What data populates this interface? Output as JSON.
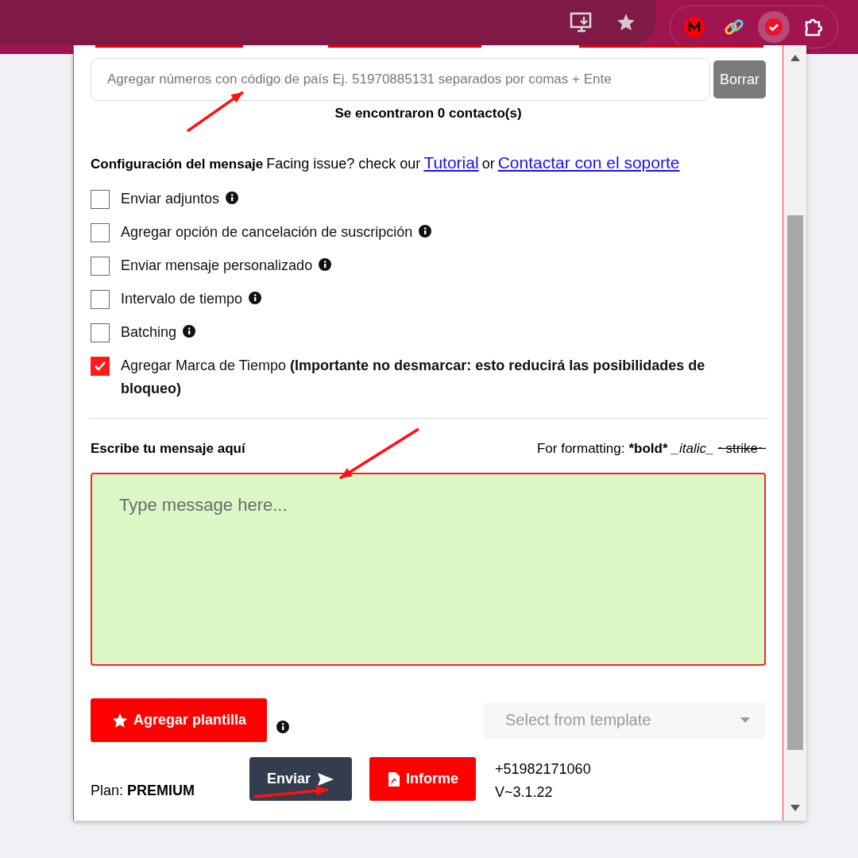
{
  "numbers": {
    "placeholder": "Agregar números con código de país Ej. 51970885131 separados por comas + Ente",
    "clear_button": "Borrar",
    "found": "Se encontraron 0 contacto(s)"
  },
  "settings": {
    "title": "Configuración del mensaje",
    "help_prefix": "Facing issue? check our",
    "help_link": "Tutorial",
    "help_joiner": "or",
    "support_link": "Contactar con el soporte"
  },
  "options": [
    {
      "label": "Enviar adjuntos ",
      "checked": false,
      "info": true
    },
    {
      "label": "Agregar opción de cancelación de suscripción",
      "checked": false,
      "info": true
    },
    {
      "label": "Enviar mensaje personalizado",
      "checked": false,
      "info": true
    },
    {
      "label": "Intervalo de tiempo",
      "checked": false,
      "info": true
    },
    {
      "label": "Batching",
      "checked": false,
      "info": true
    },
    {
      "label": "Agregar Marca de Tiempo **(Importante no desmarcar: esto reducirá las posibilidades de bloqueo)**",
      "checked": true,
      "info": false
    }
  ],
  "message": {
    "label": "Escribe tu mensaje aquí",
    "format_prefix": "For formatting:",
    "format_samples": [
      {
        "kind": "bold",
        "text": "*bold*"
      },
      {
        "kind": "italic",
        "text": "_italic_"
      },
      {
        "kind": "strike",
        "text": "~strike~"
      }
    ],
    "placeholder": "Type message here..."
  },
  "template": {
    "add_button": "Agregar plantilla",
    "select_placeholder": "Select from template"
  },
  "footer": {
    "plan": "Plan: **PREMIUM**",
    "send_button": "Enviar",
    "report_button": "Informe",
    "phone": "+51982171060",
    "version": "V~3.1.22"
  }
}
